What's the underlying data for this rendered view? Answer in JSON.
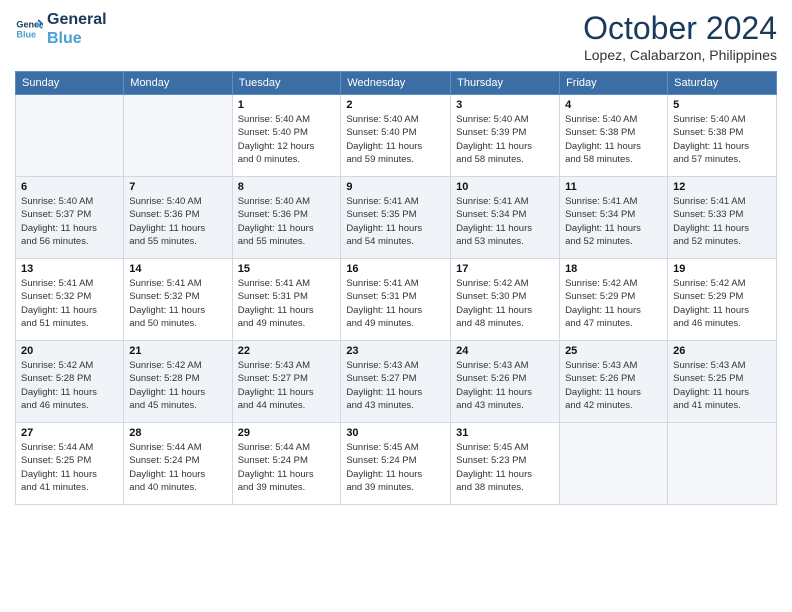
{
  "logo": {
    "line1": "General",
    "line2": "Blue"
  },
  "title": "October 2024",
  "location": "Lopez, Calabarzon, Philippines",
  "headers": [
    "Sunday",
    "Monday",
    "Tuesday",
    "Wednesday",
    "Thursday",
    "Friday",
    "Saturday"
  ],
  "weeks": [
    [
      {
        "day": "",
        "info": ""
      },
      {
        "day": "",
        "info": ""
      },
      {
        "day": "1",
        "info": "Sunrise: 5:40 AM\nSunset: 5:40 PM\nDaylight: 12 hours\nand 0 minutes."
      },
      {
        "day": "2",
        "info": "Sunrise: 5:40 AM\nSunset: 5:40 PM\nDaylight: 11 hours\nand 59 minutes."
      },
      {
        "day": "3",
        "info": "Sunrise: 5:40 AM\nSunset: 5:39 PM\nDaylight: 11 hours\nand 58 minutes."
      },
      {
        "day": "4",
        "info": "Sunrise: 5:40 AM\nSunset: 5:38 PM\nDaylight: 11 hours\nand 58 minutes."
      },
      {
        "day": "5",
        "info": "Sunrise: 5:40 AM\nSunset: 5:38 PM\nDaylight: 11 hours\nand 57 minutes."
      }
    ],
    [
      {
        "day": "6",
        "info": "Sunrise: 5:40 AM\nSunset: 5:37 PM\nDaylight: 11 hours\nand 56 minutes."
      },
      {
        "day": "7",
        "info": "Sunrise: 5:40 AM\nSunset: 5:36 PM\nDaylight: 11 hours\nand 55 minutes."
      },
      {
        "day": "8",
        "info": "Sunrise: 5:40 AM\nSunset: 5:36 PM\nDaylight: 11 hours\nand 55 minutes."
      },
      {
        "day": "9",
        "info": "Sunrise: 5:41 AM\nSunset: 5:35 PM\nDaylight: 11 hours\nand 54 minutes."
      },
      {
        "day": "10",
        "info": "Sunrise: 5:41 AM\nSunset: 5:34 PM\nDaylight: 11 hours\nand 53 minutes."
      },
      {
        "day": "11",
        "info": "Sunrise: 5:41 AM\nSunset: 5:34 PM\nDaylight: 11 hours\nand 52 minutes."
      },
      {
        "day": "12",
        "info": "Sunrise: 5:41 AM\nSunset: 5:33 PM\nDaylight: 11 hours\nand 52 minutes."
      }
    ],
    [
      {
        "day": "13",
        "info": "Sunrise: 5:41 AM\nSunset: 5:32 PM\nDaylight: 11 hours\nand 51 minutes."
      },
      {
        "day": "14",
        "info": "Sunrise: 5:41 AM\nSunset: 5:32 PM\nDaylight: 11 hours\nand 50 minutes."
      },
      {
        "day": "15",
        "info": "Sunrise: 5:41 AM\nSunset: 5:31 PM\nDaylight: 11 hours\nand 49 minutes."
      },
      {
        "day": "16",
        "info": "Sunrise: 5:41 AM\nSunset: 5:31 PM\nDaylight: 11 hours\nand 49 minutes."
      },
      {
        "day": "17",
        "info": "Sunrise: 5:42 AM\nSunset: 5:30 PM\nDaylight: 11 hours\nand 48 minutes."
      },
      {
        "day": "18",
        "info": "Sunrise: 5:42 AM\nSunset: 5:29 PM\nDaylight: 11 hours\nand 47 minutes."
      },
      {
        "day": "19",
        "info": "Sunrise: 5:42 AM\nSunset: 5:29 PM\nDaylight: 11 hours\nand 46 minutes."
      }
    ],
    [
      {
        "day": "20",
        "info": "Sunrise: 5:42 AM\nSunset: 5:28 PM\nDaylight: 11 hours\nand 46 minutes."
      },
      {
        "day": "21",
        "info": "Sunrise: 5:42 AM\nSunset: 5:28 PM\nDaylight: 11 hours\nand 45 minutes."
      },
      {
        "day": "22",
        "info": "Sunrise: 5:43 AM\nSunset: 5:27 PM\nDaylight: 11 hours\nand 44 minutes."
      },
      {
        "day": "23",
        "info": "Sunrise: 5:43 AM\nSunset: 5:27 PM\nDaylight: 11 hours\nand 43 minutes."
      },
      {
        "day": "24",
        "info": "Sunrise: 5:43 AM\nSunset: 5:26 PM\nDaylight: 11 hours\nand 43 minutes."
      },
      {
        "day": "25",
        "info": "Sunrise: 5:43 AM\nSunset: 5:26 PM\nDaylight: 11 hours\nand 42 minutes."
      },
      {
        "day": "26",
        "info": "Sunrise: 5:43 AM\nSunset: 5:25 PM\nDaylight: 11 hours\nand 41 minutes."
      }
    ],
    [
      {
        "day": "27",
        "info": "Sunrise: 5:44 AM\nSunset: 5:25 PM\nDaylight: 11 hours\nand 41 minutes."
      },
      {
        "day": "28",
        "info": "Sunrise: 5:44 AM\nSunset: 5:24 PM\nDaylight: 11 hours\nand 40 minutes."
      },
      {
        "day": "29",
        "info": "Sunrise: 5:44 AM\nSunset: 5:24 PM\nDaylight: 11 hours\nand 39 minutes."
      },
      {
        "day": "30",
        "info": "Sunrise: 5:45 AM\nSunset: 5:24 PM\nDaylight: 11 hours\nand 39 minutes."
      },
      {
        "day": "31",
        "info": "Sunrise: 5:45 AM\nSunset: 5:23 PM\nDaylight: 11 hours\nand 38 minutes."
      },
      {
        "day": "",
        "info": ""
      },
      {
        "day": "",
        "info": ""
      }
    ]
  ]
}
